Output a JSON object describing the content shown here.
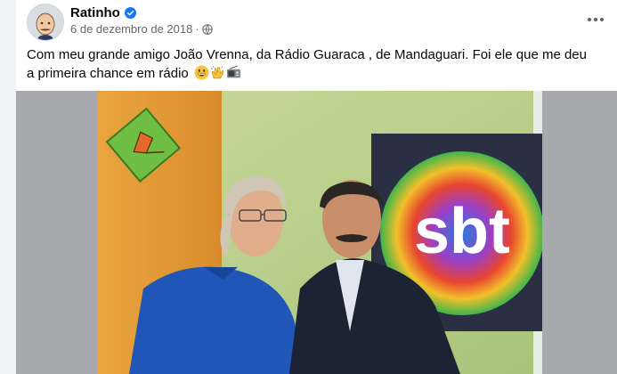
{
  "post": {
    "author": "Ratinho",
    "date": "6 de dezembro de 2018",
    "meta_separator": "·",
    "text": "Com meu grande amigo João Vrenna, da Rádio Guaraca , de Mandaguari. Foi ele que me deu a primeira chance em rádio",
    "emojis": [
      "grinning-face-emoji",
      "clapping-hands-emoji",
      "radio-emoji"
    ]
  },
  "photo": {
    "logo_text": "sbt"
  },
  "icons": {
    "verified": "verified-badge-icon",
    "audience": "globe-icon",
    "more": "more-options-icon"
  },
  "colors": {
    "author_text": "#050505",
    "meta_text": "#65676b",
    "verified_blue": "#1877f2",
    "wall_orange": "#e5a445",
    "wall_green": "#b7cf8e"
  }
}
